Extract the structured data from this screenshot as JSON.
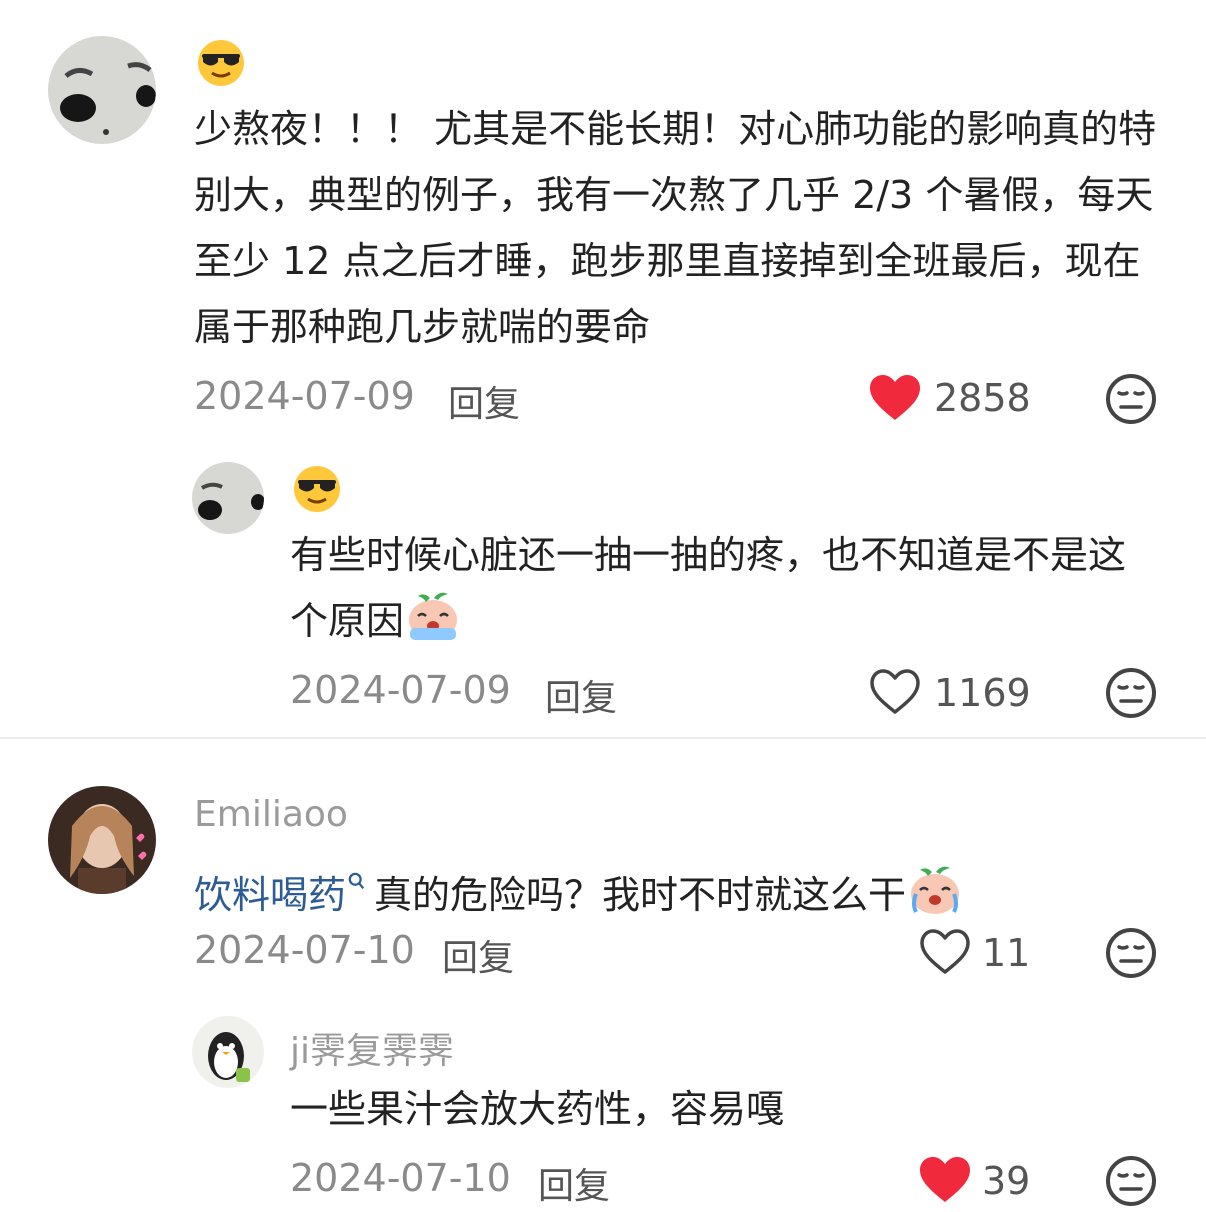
{
  "comments": [
    {
      "username": "",
      "emoji_name": "cool-sunglasses-emoji",
      "text": "少熬夜！！！ 尤其是不能长期！对心肺功能的影响真的特别大，典型的例子，我有一次熬了几乎 2/3 个暑假，每天至少 12 点之后才睡，跑步那里直接掉到全班最后，现在属于那种跑几步就喘的要命",
      "date": "2024-07-09",
      "reply_label": "回复",
      "likes": "2858",
      "liked": true,
      "replies": [
        {
          "username": "",
          "emoji_name": "cool-sunglasses-emoji",
          "text": "有些时候心脏还一抽一抽的疼，也不知道是不是这个原因",
          "sticker": "crying-peach-sticker",
          "date": "2024-07-09",
          "reply_label": "回复",
          "likes": "1169",
          "liked": false
        }
      ]
    },
    {
      "username": "Emiliaoo",
      "link_text": "饮料喝药",
      "text": "真的危险吗？我时不时就这么干",
      "sticker": "crying-peach-sticker",
      "date": "2024-07-10",
      "reply_label": "回复",
      "likes": "11",
      "liked": false,
      "replies": [
        {
          "username": "ji霁复霁霁",
          "text": "一些果汁会放大药性，容易嘎",
          "date": "2024-07-10",
          "reply_label": "回复",
          "likes": "39",
          "liked": true
        }
      ]
    }
  ],
  "colors": {
    "heart_red": "#f0293c",
    "link_blue": "#2d5b93",
    "meta_gray": "#8a8a8a"
  }
}
